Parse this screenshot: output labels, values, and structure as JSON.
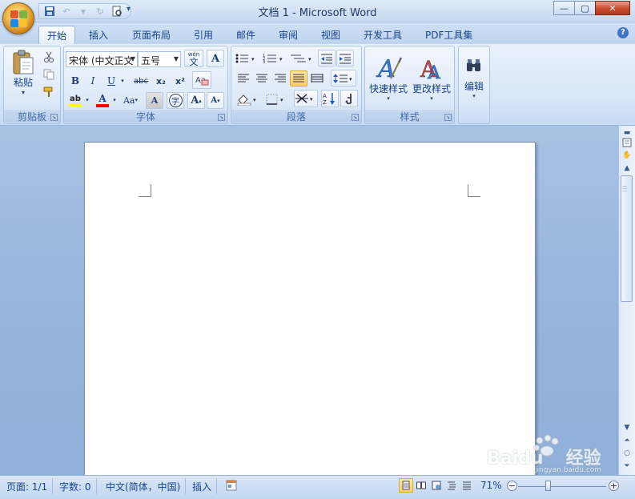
{
  "window": {
    "title": "文档 1 - Microsoft Word",
    "minimize": "—",
    "maximize": "▢",
    "close": "✕"
  },
  "quick_access": {
    "items": [
      "save-icon",
      "undo-icon",
      "redo-icon",
      "print-preview-icon"
    ],
    "more": "▾"
  },
  "tabs": [
    {
      "label": "开始",
      "active": true
    },
    {
      "label": "插入"
    },
    {
      "label": "页面布局"
    },
    {
      "label": "引用"
    },
    {
      "label": "邮件"
    },
    {
      "label": "审阅"
    },
    {
      "label": "视图"
    },
    {
      "label": "开发工具"
    },
    {
      "label": "PDF工具集"
    }
  ],
  "help": "?",
  "ribbon": {
    "clipboard": {
      "label": "剪贴板",
      "paste": "粘贴",
      "paste_arrow": "▾"
    },
    "font": {
      "label": "字体",
      "font_name": "宋体 (中文正文",
      "font_size": "五号",
      "bold": "B",
      "italic": "I",
      "underline": "U",
      "strike": "abc",
      "subscript": "x₂",
      "superscript": "x²",
      "grow": "A",
      "shrink": "A",
      "change_case": "Aa",
      "char_shading": "A",
      "enclose": "字",
      "phonetic": "wén",
      "phonetic_char": "文",
      "char_border": "A"
    },
    "paragraph": {
      "label": "段落"
    },
    "styles": {
      "label": "样式",
      "quick_styles": "快速样式",
      "change_styles": "更改样式"
    },
    "editing": {
      "label": "编辑"
    }
  },
  "status": {
    "page": "页面: 1/1",
    "words": "字数: 0",
    "language": "中文(简体，中国)",
    "mode": "插入",
    "zoom": "71%",
    "zoom_level": 0.71
  },
  "watermark": {
    "brand": "Baidu",
    "suffix": "经验",
    "url": "jingyan.baidu.com"
  },
  "colors": {
    "accent": "#15428b",
    "highlight": "#ffff00",
    "font_color": "#ff0000"
  }
}
